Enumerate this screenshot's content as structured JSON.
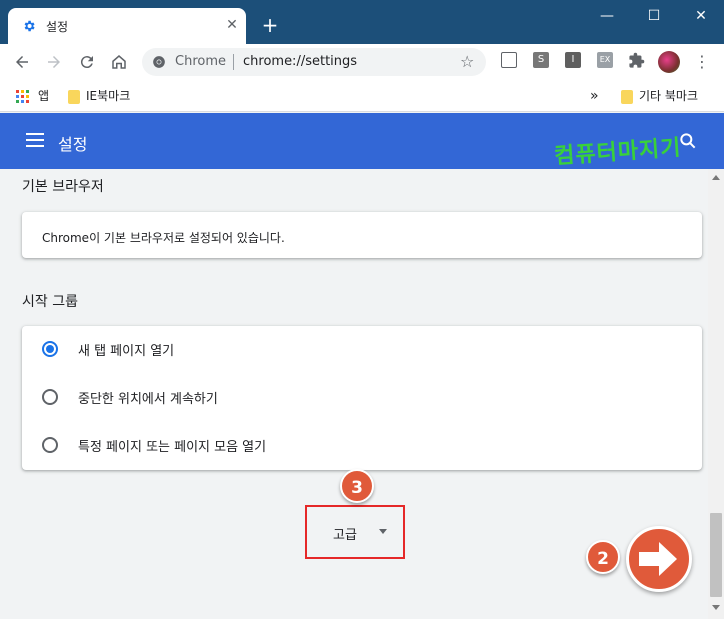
{
  "browser": {
    "tab_title": "설정",
    "new_tab_symbol": "+",
    "window_controls": {
      "minimize": "—",
      "maximize": "☐",
      "close": "✕"
    }
  },
  "toolbar": {
    "back_icon": "arrow-left",
    "forward_icon": "arrow-right",
    "reload_icon": "reload",
    "home_icon": "home",
    "site_label": "Chrome",
    "url": "chrome://settings",
    "extensions": [
      {
        "label": "",
        "color": "#5f6368"
      },
      {
        "label": "S",
        "color": "#777777"
      },
      {
        "label": "I",
        "color": "#5f5f5f"
      },
      {
        "label": "EX",
        "color": "#9aa0a6"
      }
    ]
  },
  "bookmarks": {
    "apps_label": "앱",
    "ie_label": "IE북마크",
    "overflow": "»",
    "other_label": "기타 북마크"
  },
  "header": {
    "title": "설정",
    "watermark": "컴퓨터마지기"
  },
  "default_browser": {
    "section_title": "기본 브라우저",
    "status": "Chrome이 기본 브라우저로 설정되어 있습니다."
  },
  "startup": {
    "section_title": "시작 그룹",
    "options": [
      {
        "label": "새 탭 페이지 열기",
        "checked": true
      },
      {
        "label": "중단한 위치에서 계속하기",
        "checked": false
      },
      {
        "label": "특정 페이지 또는 페이지 모음 열기",
        "checked": false
      }
    ]
  },
  "advanced": {
    "label": "고급"
  },
  "annotations": {
    "step3": "3",
    "step2": "2",
    "accent": "#e05a3a"
  }
}
